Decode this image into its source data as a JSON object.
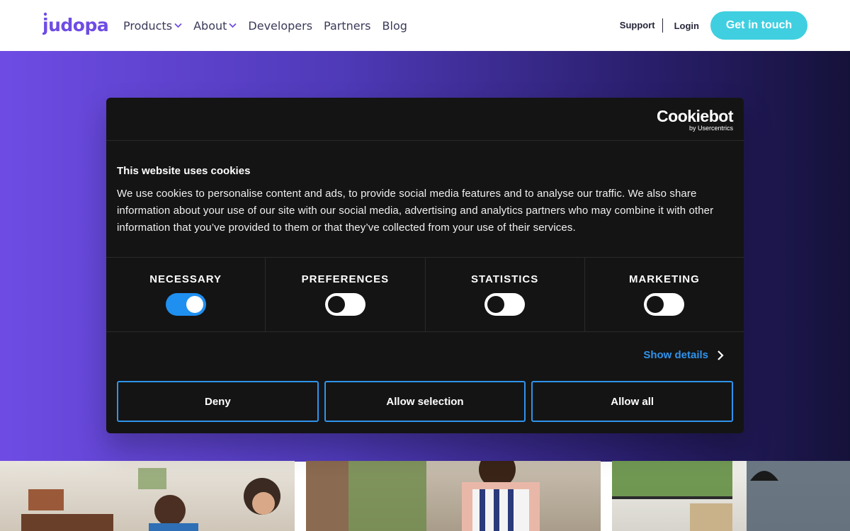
{
  "header": {
    "nav": [
      {
        "label": "Products",
        "dropdown": true
      },
      {
        "label": "About",
        "dropdown": true
      },
      {
        "label": "Developers",
        "dropdown": false
      },
      {
        "label": "Partners",
        "dropdown": false
      },
      {
        "label": "Blog",
        "dropdown": false
      }
    ],
    "support_label": "Support",
    "login_label": "Login",
    "cta_label": "Get in touch"
  },
  "colors": {
    "brand_purple": "#6e4ce4",
    "cta_teal": "#3fcfe0",
    "dialog_bg": "#141414",
    "accent_blue": "#2f93ec",
    "toggle_on": "#1f8ff0"
  },
  "cookie_dialog": {
    "brand": {
      "name": "Cookiebot",
      "by": "by Usercentrics"
    },
    "title": "This website uses cookies",
    "body": "We use cookies to personalise content and ads, to provide social media features and to analyse our traffic. We also share information about your use of our site with our social media, advertising and analytics partners who may combine it with other information that you’ve provided to them or that they’ve collected from your use of their services.",
    "toggles": [
      {
        "label": "NECESSARY",
        "on": true
      },
      {
        "label": "PREFERENCES",
        "on": false
      },
      {
        "label": "STATISTICS",
        "on": false
      },
      {
        "label": "MARKETING",
        "on": false
      }
    ],
    "show_details_label": "Show details",
    "buttons": {
      "deny": "Deny",
      "allow_selection": "Allow selection",
      "allow_all": "Allow all"
    }
  },
  "icons": {
    "chevron_down": "chevron-down-icon",
    "chevron_right": "chevron-right-icon",
    "logo": "judopay-logo"
  }
}
